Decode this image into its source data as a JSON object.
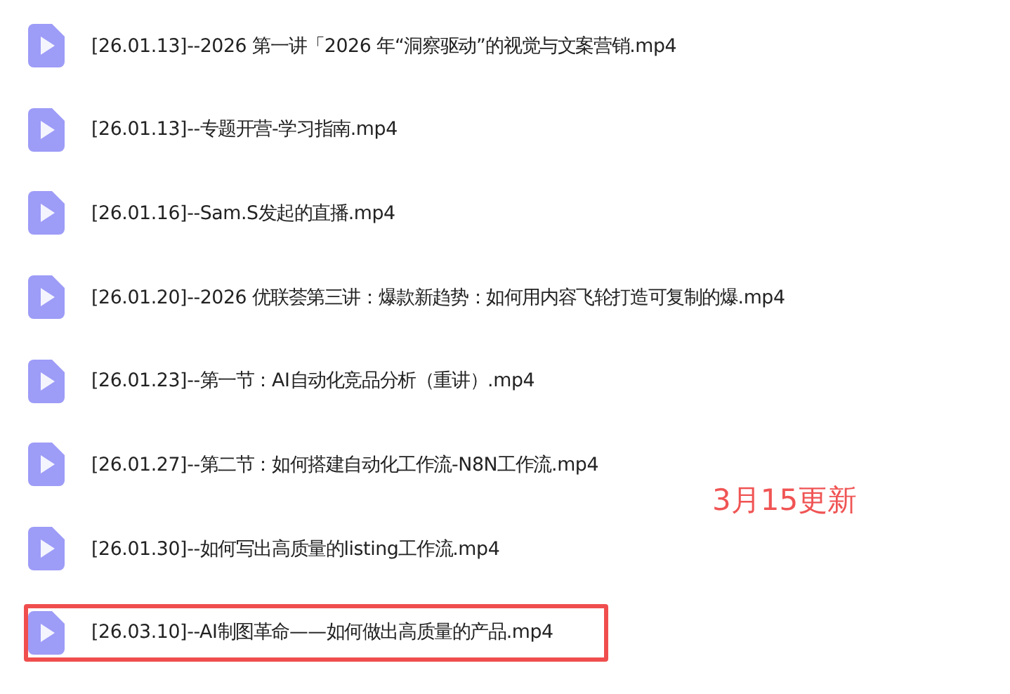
{
  "files": [
    {
      "name": "[26.01.13]--2026 第一讲「2026 年“洞察驱动”的视觉与文案营销.mp4",
      "highlighted": false
    },
    {
      "name": "[26.01.13]--专题开营-学习指南.mp4",
      "highlighted": false
    },
    {
      "name": "[26.01.16]--Sam.S发起的直播.mp4",
      "highlighted": false
    },
    {
      "name": "[26.01.20]--2026 优联荟第三讲：爆款新趋势：如何用内容飞轮打造可复制的爆.mp4",
      "highlighted": false
    },
    {
      "name": "[26.01.23]--第一节：AI自动化竞品分析（重讲）.mp4",
      "highlighted": false
    },
    {
      "name": "[26.01.27]--第二节：如何搭建自动化工作流-N8N工作流.mp4",
      "highlighted": false
    },
    {
      "name": "[26.01.30]--如何写出高质量的listing工作流.mp4",
      "highlighted": false
    },
    {
      "name": "[26.03.10]--AI制图革命——如何做出高质量的产品.mp4",
      "highlighted": true
    }
  ],
  "annotation": "3月15更新"
}
